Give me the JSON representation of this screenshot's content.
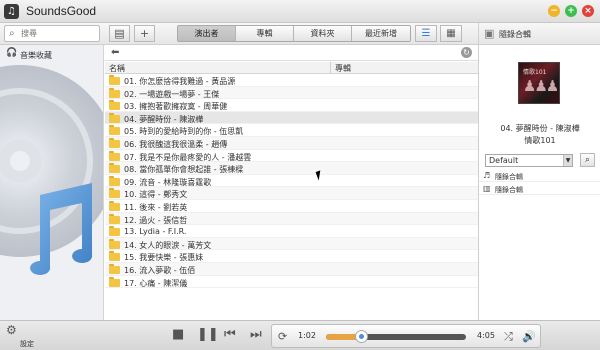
{
  "app": {
    "title": "SoundsGood",
    "icon": "music-note-icon"
  },
  "window_controls": {
    "minimize": "−",
    "maximize": "+",
    "close": "×"
  },
  "toolbar": {
    "search": {
      "placeholder": "搜尋",
      "value": "",
      "icon": "search-icon"
    },
    "add_label": "+",
    "tabs": [
      {
        "label": "演出者",
        "active": true
      },
      {
        "label": "專輯",
        "active": false
      },
      {
        "label": "資料夾",
        "active": false
      },
      {
        "label": "最近新增",
        "active": false
      }
    ],
    "view_list": "list-view-icon",
    "view_grid": "grid-view-icon"
  },
  "right_header": {
    "label": "隨錄合輯",
    "icon": "playlist-icon"
  },
  "sidebar": {
    "favorite_label": "音樂收藏",
    "favorite_icon": "headphones-icon"
  },
  "table": {
    "columns": [
      "名稱",
      "專輯"
    ],
    "rows": [
      {
        "name": "01. 你怎麼捨得我難過 - 黃品源"
      },
      {
        "name": "02. 一場遊戲一場夢 - 王傑"
      },
      {
        "name": "03. 擁抱著歡擁寂寞 - 周華健"
      },
      {
        "name": "04. 夢醒時份 - 陳淑樺"
      },
      {
        "name": "05. 時到的愛給時到的你 - 伍思凱"
      },
      {
        "name": "06. 我很醜這我很溫柔 - 趙傳"
      },
      {
        "name": "07. 我是不是你最疼愛的人 - 潘越雲"
      },
      {
        "name": "08. 當你孤單你會想起誰 - 張棟樑"
      },
      {
        "name": "09. 流音 - 林隆璇喜霆歌"
      },
      {
        "name": "10. 這得 - 鄭秀文"
      },
      {
        "name": "11. 後來 - 劉若英"
      },
      {
        "name": "12. 過火 - 張信哲"
      },
      {
        "name": "13. Lydia - F.I.R."
      },
      {
        "name": "14. 女人的眼淚 - 萬芳文"
      },
      {
        "name": "15. 我要快樂 - 張惠妹"
      },
      {
        "name": "16. 流入夢歌 - 伍佰"
      },
      {
        "name": "17. 心痛 - 陳潔儀"
      }
    ],
    "hover_row": 3
  },
  "now_playing": {
    "cover_text": "情歌101",
    "title": "04. 夢醒時份 - 陳淑樺",
    "album": "情歌101"
  },
  "playlists": {
    "selected": "Default",
    "items": [
      {
        "label": "隨錄合輯",
        "icon": "music-note-icon"
      },
      {
        "label": "隨錄合輯",
        "icon": "bar-chart-icon"
      }
    ]
  },
  "bottom": {
    "settings_label": "設定",
    "elapsed": "1:02",
    "duration": "4:05",
    "progress": 0.253
  }
}
